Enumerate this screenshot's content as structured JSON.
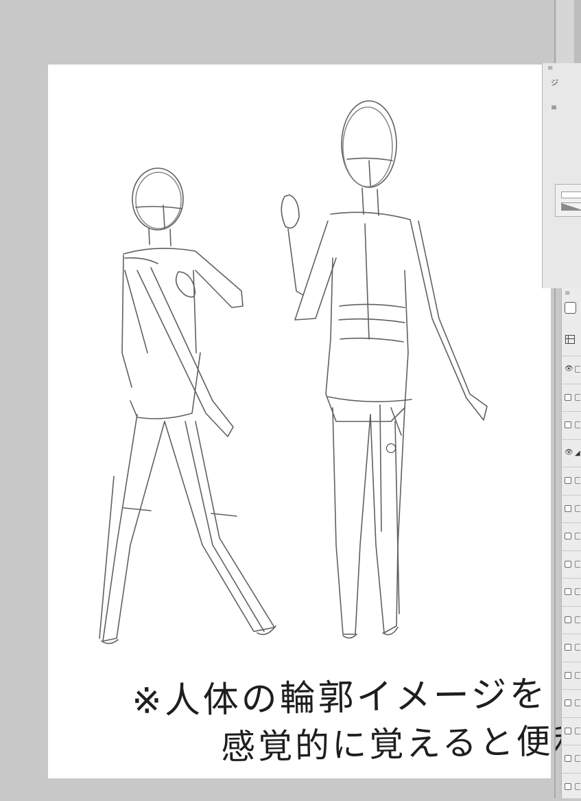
{
  "canvas": {
    "caption_line1": "※人体の輪郭イメージを",
    "caption_line2": "感覚的に覚えると便利"
  },
  "panel": {
    "grip_glyph": "≡",
    "tool_glyph_1": "ジ",
    "tool_glyph_2": "≡"
  },
  "layers": {
    "grip_glyph": "≡",
    "rows": [
      {
        "visible": true,
        "active": false,
        "vis_glyph": "👁"
      },
      {
        "visible": false,
        "active": false,
        "vis_glyph": ""
      },
      {
        "visible": false,
        "active": false,
        "vis_glyph": ""
      },
      {
        "visible": true,
        "active": true,
        "vis_glyph": "👁"
      },
      {
        "visible": false,
        "active": false,
        "vis_glyph": ""
      },
      {
        "visible": false,
        "active": false,
        "vis_glyph": ""
      },
      {
        "visible": false,
        "active": false,
        "vis_glyph": ""
      },
      {
        "visible": false,
        "active": false,
        "vis_glyph": ""
      },
      {
        "visible": false,
        "active": false,
        "vis_glyph": ""
      },
      {
        "visible": false,
        "active": false,
        "vis_glyph": ""
      },
      {
        "visible": false,
        "active": false,
        "vis_glyph": ""
      },
      {
        "visible": false,
        "active": false,
        "vis_glyph": ""
      },
      {
        "visible": false,
        "active": false,
        "vis_glyph": ""
      },
      {
        "visible": false,
        "active": false,
        "vis_glyph": ""
      },
      {
        "visible": false,
        "active": false,
        "vis_glyph": ""
      },
      {
        "visible": false,
        "active": false,
        "vis_glyph": ""
      }
    ]
  },
  "colors": {
    "canvas_bg": "#c8c8c8",
    "paper": "#ffffff",
    "pencil": "#5a5a5a"
  },
  "icons": {
    "eye": "eye-icon",
    "pen": "pen-icon",
    "layer_list": "layer-list-icon",
    "brush_cursor": "brush-cursor-icon"
  }
}
